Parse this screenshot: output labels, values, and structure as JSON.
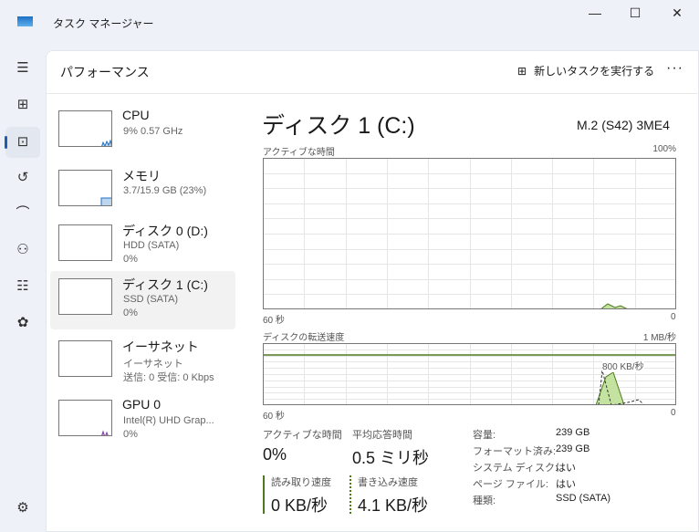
{
  "window": {
    "title": "タスク マネージャー",
    "minimize": "—",
    "maximize": "☐",
    "close": "✕"
  },
  "page": {
    "title": "パフォーマンス",
    "new_task": "新しいタスクを実行する",
    "more": "···"
  },
  "nav": [
    {
      "icon": "hamburger-icon",
      "glyph": "☰"
    },
    {
      "icon": "processes-icon",
      "glyph": "⊞"
    },
    {
      "icon": "performance-icon",
      "glyph": "⊡"
    },
    {
      "icon": "history-icon",
      "glyph": "↺"
    },
    {
      "icon": "startup-icon",
      "glyph": "⌒"
    },
    {
      "icon": "users-icon",
      "glyph": "⚇"
    },
    {
      "icon": "details-icon",
      "glyph": "☷"
    },
    {
      "icon": "services-icon",
      "glyph": "✿"
    },
    {
      "icon": "settings-icon",
      "glyph": "⚙"
    }
  ],
  "devices": [
    {
      "name": "CPU",
      "sub1": "9%  0.57 GHz",
      "sub2": ""
    },
    {
      "name": "メモリ",
      "sub1": "3.7/15.9 GB (23%)",
      "sub2": ""
    },
    {
      "name": "ディスク 0 (D:)",
      "sub1": "HDD (SATA)",
      "sub2": "0%"
    },
    {
      "name": "ディスク 1 (C:)",
      "sub1": "SSD (SATA)",
      "sub2": "0%"
    },
    {
      "name": "イーサネット",
      "sub1": "イーサネット",
      "sub2": "送信: 0 受信: 0 Kbps"
    },
    {
      "name": "GPU 0",
      "sub1": "Intel(R) UHD Grap...",
      "sub2": "0%"
    }
  ],
  "detail": {
    "title": "ディスク 1 (C:)",
    "model": "M.2 (S42) 3ME4",
    "chart1": {
      "label": "アクティブな時間",
      "max": "100%",
      "left": "60 秒",
      "right": "0"
    },
    "chart2": {
      "label": "ディスクの転送速度",
      "max": "1 MB/秒",
      "mid": "800 KB/秒",
      "left": "60 秒",
      "right": "0"
    },
    "stats": {
      "active_label": "アクティブな時間",
      "active": "0%",
      "resp_label": "平均応答時間",
      "resp": "0.5 ミリ秒",
      "read_label": "読み取り速度",
      "read": "0 KB/秒",
      "write_label": "書き込み速度",
      "write": "4.1 KB/秒"
    },
    "props": [
      [
        "容量:",
        "239 GB"
      ],
      [
        "フォーマット済み:",
        "239 GB"
      ],
      [
        "システム ディスク:",
        "はい"
      ],
      [
        "ページ ファイル:",
        "はい"
      ],
      [
        "種類:",
        "SSD (SATA)"
      ]
    ]
  },
  "colors": {
    "accent": "#4d7a1f",
    "fill": "#c5e3a0",
    "cpu": "#1f6fbf",
    "gpu": "#7a3fa0"
  }
}
